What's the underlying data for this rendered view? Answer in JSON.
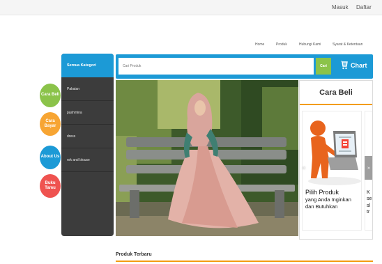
{
  "topbar": {
    "login": "Masuk",
    "register": "Daftar"
  },
  "nav": [
    "Home",
    "Produk",
    "Hubungi Kami",
    "Syarat & Ketentuan"
  ],
  "sidebar": {
    "header": "Semua Kategori",
    "items": [
      "Pakaian",
      "pashmina",
      "dress",
      "rok and blouse"
    ]
  },
  "search": {
    "placeholder": "Cari Produk",
    "button": "Cari"
  },
  "cart": {
    "label": "Chart"
  },
  "side_buttons": [
    {
      "label": "Cara Beli",
      "color": "#8bc34a"
    },
    {
      "label": "Cara Bayar",
      "color": "#f7a533"
    },
    {
      "label": "About Us",
      "color": "#1c9ad6"
    },
    {
      "label": "Buku Tamu",
      "color": "#ef5350"
    }
  ],
  "cara_beli": {
    "title": "Cara Beli",
    "caption_1": "Pilih Produk",
    "caption_2": "yang Anda Inginkan",
    "caption_3": "dan Butuhkan",
    "peek_text": [
      "K",
      "se",
      "sl",
      "tr"
    ],
    "prev_arrow": "«",
    "next_arrow": "»"
  },
  "section": {
    "title": "Produk Terbaru"
  },
  "colors": {
    "accent": "#1c9ad6",
    "orange": "#f39c12",
    "sidebar_bg": "#3c3c3c",
    "green": "#8bc34a"
  },
  "icons": {
    "cart": "cart-icon"
  }
}
